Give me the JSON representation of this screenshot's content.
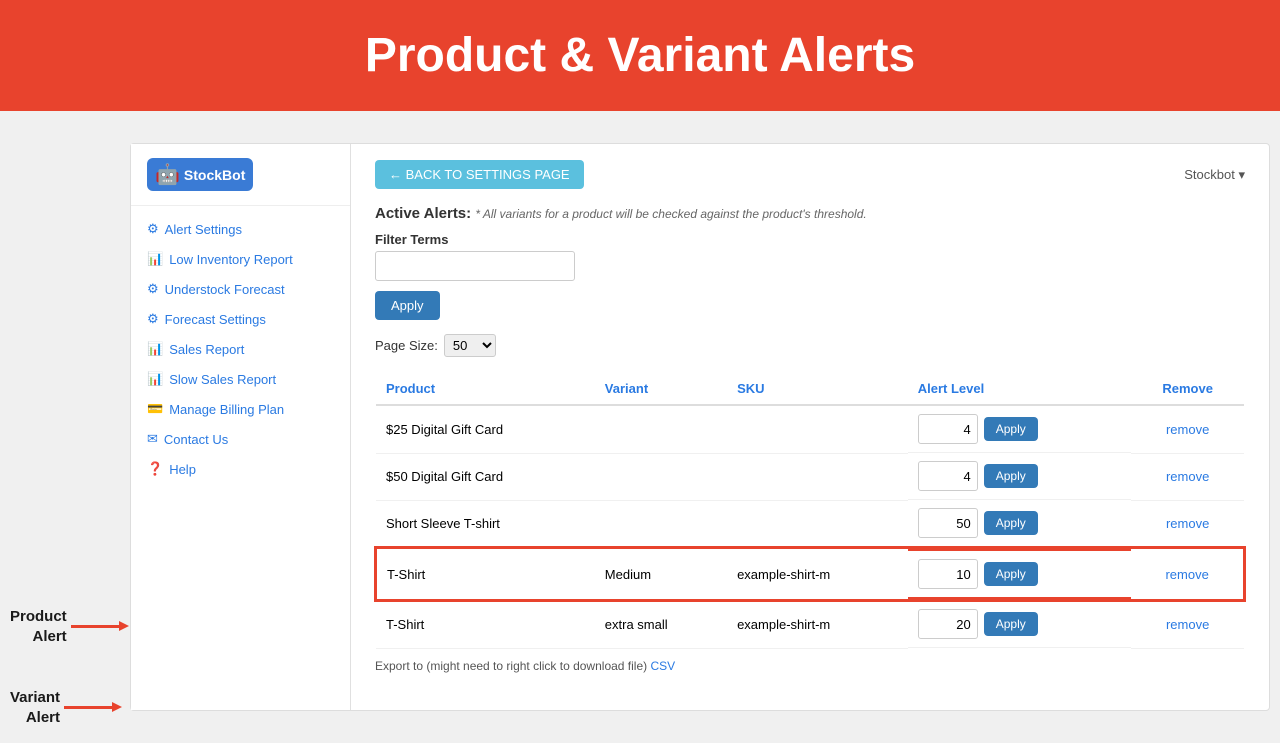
{
  "banner": {
    "title": "Product & Variant Alerts"
  },
  "header": {
    "back_button": "← BACK TO SETTINGS PAGE",
    "user_menu": "Stockbot ▾"
  },
  "sidebar": {
    "logo_text": "StockBot",
    "nav_items": [
      {
        "id": "alert-settings",
        "icon": "⚙",
        "label": "Alert Settings"
      },
      {
        "id": "low-inventory",
        "icon": "📊",
        "label": "Low Inventory Report"
      },
      {
        "id": "understock",
        "icon": "⚙",
        "label": "Understock Forecast"
      },
      {
        "id": "forecast-settings",
        "icon": "⚙",
        "label": "Forecast Settings"
      },
      {
        "id": "sales-report",
        "icon": "📊",
        "label": "Sales Report"
      },
      {
        "id": "slow-sales",
        "icon": "📊",
        "label": "Slow Sales Report"
      },
      {
        "id": "billing",
        "icon": "💳",
        "label": "Manage Billing Plan"
      },
      {
        "id": "contact",
        "icon": "✉",
        "label": "Contact Us"
      },
      {
        "id": "help",
        "icon": "❓",
        "label": "Help"
      }
    ]
  },
  "active_alerts": {
    "title": "Active Alerts:",
    "subtitle": "* All variants for a product will be checked against the product's threshold.",
    "filter_label": "Filter Terms",
    "filter_placeholder": "",
    "apply_button": "Apply",
    "page_size_label": "Page Size:",
    "page_size_value": "50"
  },
  "table": {
    "columns": [
      "Product",
      "Variant",
      "SKU",
      "Alert Level",
      "Remove"
    ],
    "rows": [
      {
        "product": "$25 Digital Gift Card",
        "variant": "",
        "sku": "",
        "alert_level": "4",
        "highlighted": false
      },
      {
        "product": "$50 Digital Gift Card",
        "variant": "",
        "sku": "",
        "alert_level": "4",
        "highlighted": false
      },
      {
        "product": "Short Sleeve T-shirt",
        "variant": "",
        "sku": "",
        "alert_level": "50",
        "highlighted": false
      },
      {
        "product": "T-Shirt",
        "variant": "Medium",
        "sku": "example-shirt-m",
        "alert_level": "10",
        "highlighted": true
      },
      {
        "product": "T-Shirt",
        "variant": "extra small",
        "sku": "example-shirt-m",
        "alert_level": "20",
        "highlighted": false
      }
    ],
    "apply_label": "Apply",
    "remove_label": "remove"
  },
  "export": {
    "text": "Export to (might need to right click to download file)",
    "csv_label": "CSV"
  },
  "annotations": [
    {
      "id": "product-alert",
      "label": "Product\nAlert"
    },
    {
      "id": "variant-alert",
      "label": "Variant\nAlert"
    }
  ]
}
